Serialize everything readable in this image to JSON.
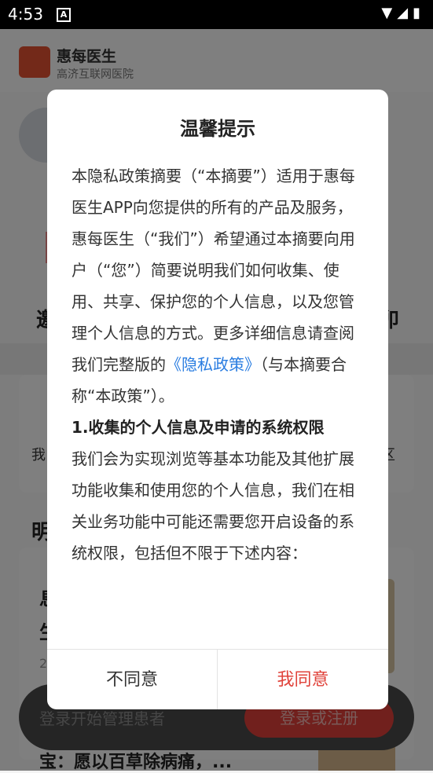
{
  "status_bar": {
    "time": "4:53",
    "notification_icon": "A",
    "icons": "▼◢▮"
  },
  "app": {
    "name": "惠每医生",
    "subtitle": "高济互联网医院",
    "bg_big_left": "邀",
    "bg_big_right": "卯",
    "bg_small_left": "我",
    "bg_small_right": "区",
    "bg_section_heading": "明",
    "bg_card_title_line1": "息",
    "bg_card_title_line2": "生",
    "bg_card_count": "2",
    "bg_bottom_text": "宝：愿以百草除病痛，..."
  },
  "login_bar": {
    "prompt": "登录开始管理患者",
    "button": "登录或注册"
  },
  "dialog": {
    "title": "温馨提示",
    "para1_before_link": "本隐私政策摘要（“本摘要”）适用于惠每医生APP向您提供的所有的产品及服务，惠每医生（“我们”）希望通过本摘要向用户（“您”）简要说明我们如何收集、使用、共享、保护您的个人信息，以及您管理个人信息的方式。更多详细信息请查阅我们完整版的",
    "privacy_link": "《隐私政策》",
    "para1_after_link": "（与本摘要合称“本政策”）。",
    "section1_heading": "1.收集的个人信息及申请的系统权限",
    "section1_body": "我们会为实现浏览等基本功能及其他扩展功能收集和使用您的个人信息，我们在相关业务功能中可能还需要您开启设备的系统权限，包括但不限于下述内容：",
    "disagree": "不同意",
    "agree": "我同意"
  },
  "colors": {
    "accent": "#e0433b",
    "link": "#2a7de1"
  }
}
